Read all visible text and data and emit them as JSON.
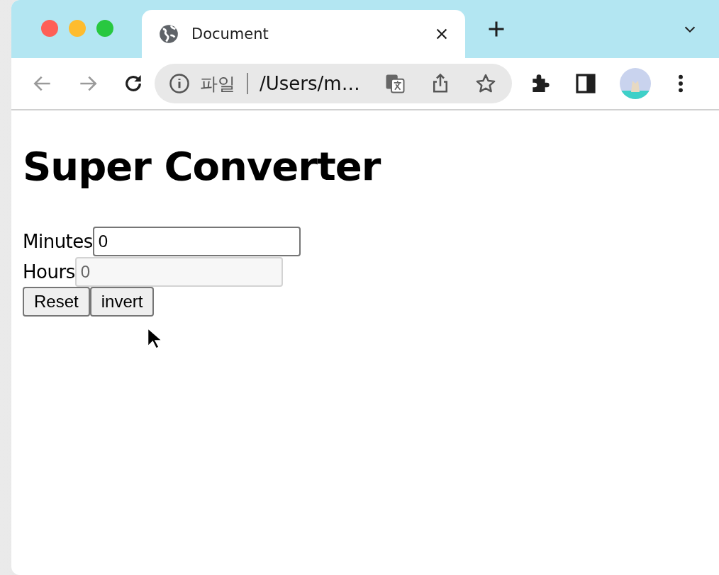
{
  "window": {
    "tabs": [
      {
        "title": "Document",
        "selected": true
      }
    ],
    "address_bar": {
      "scheme_label": "파일",
      "url": "/Users/m…"
    }
  },
  "page": {
    "heading": "Super Converter",
    "fields": [
      {
        "label": "Minutes",
        "value": "0",
        "disabled": false
      },
      {
        "label": "Hours",
        "value": "0",
        "disabled": true
      }
    ],
    "buttons": [
      "Reset",
      "invert"
    ]
  }
}
